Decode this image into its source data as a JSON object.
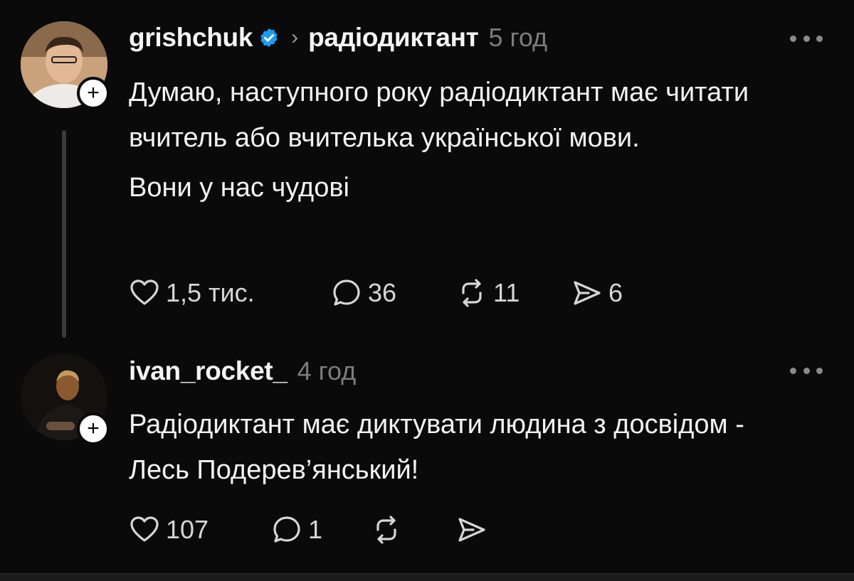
{
  "posts": [
    {
      "username": "grishchuk",
      "verified": true,
      "topic": "радіодиктант",
      "time": "5 год",
      "paragraphs": [
        "Думаю, наступного року радіодиктант має читати вчитель або вчителька української мови.",
        "Вони у нас чудові"
      ],
      "likes": "1,5 тис.",
      "replies": "36",
      "reposts": "11",
      "shares": "6"
    },
    {
      "username": "ivan_rocket_",
      "time": "4 год",
      "paragraphs": [
        "Радіодиктант має диктувати людина з досвідом - Лесь Подерев’янський!"
      ],
      "likes": "107",
      "replies": "1"
    }
  ],
  "icons": {
    "verified": "verified-badge-icon",
    "like": "heart-icon",
    "reply": "comment-bubble-icon",
    "repost": "repost-icon",
    "share": "send-icon",
    "more": "more-dots-icon",
    "follow": "plus-icon"
  },
  "colors": {
    "background": "#0a0a0a",
    "verified": "#1d9bf0",
    "muted": "#7c7c7c"
  }
}
